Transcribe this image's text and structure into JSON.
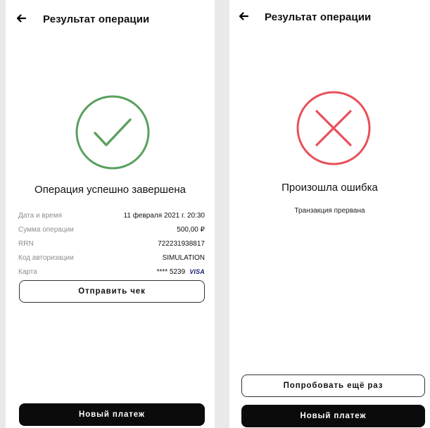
{
  "success_screen": {
    "header_title": "Результат операции",
    "status_title": "Операция успешно завершена",
    "details": [
      {
        "label": "Дата и время",
        "value": "11 февраля 2021 г. 20:30"
      },
      {
        "label": "Сумма операции",
        "value": "500,00 ₽"
      },
      {
        "label": "RRN",
        "value": "722231938817"
      },
      {
        "label": "Код авторизации",
        "value": "SIMULATION"
      },
      {
        "label": "Карта",
        "value": "**** 5239",
        "brand": "VISA"
      }
    ],
    "send_receipt_label": "Отправить чек",
    "new_payment_label": "Новый платеж",
    "icons": {
      "back": "arrow-left-icon",
      "status": "check-circle-icon"
    },
    "colors": {
      "status": "#5aa05e",
      "card_brand": "#1a1f71"
    }
  },
  "error_screen": {
    "header_title": "Результат операции",
    "status_title": "Произошла ошибка",
    "description": "Транзакция прервана",
    "retry_label": "Попробовать ещё раз",
    "new_payment_label": "Новый платеж",
    "icons": {
      "back": "arrow-left-icon",
      "status": "x-circle-icon"
    },
    "colors": {
      "status": "#e8505b"
    }
  }
}
